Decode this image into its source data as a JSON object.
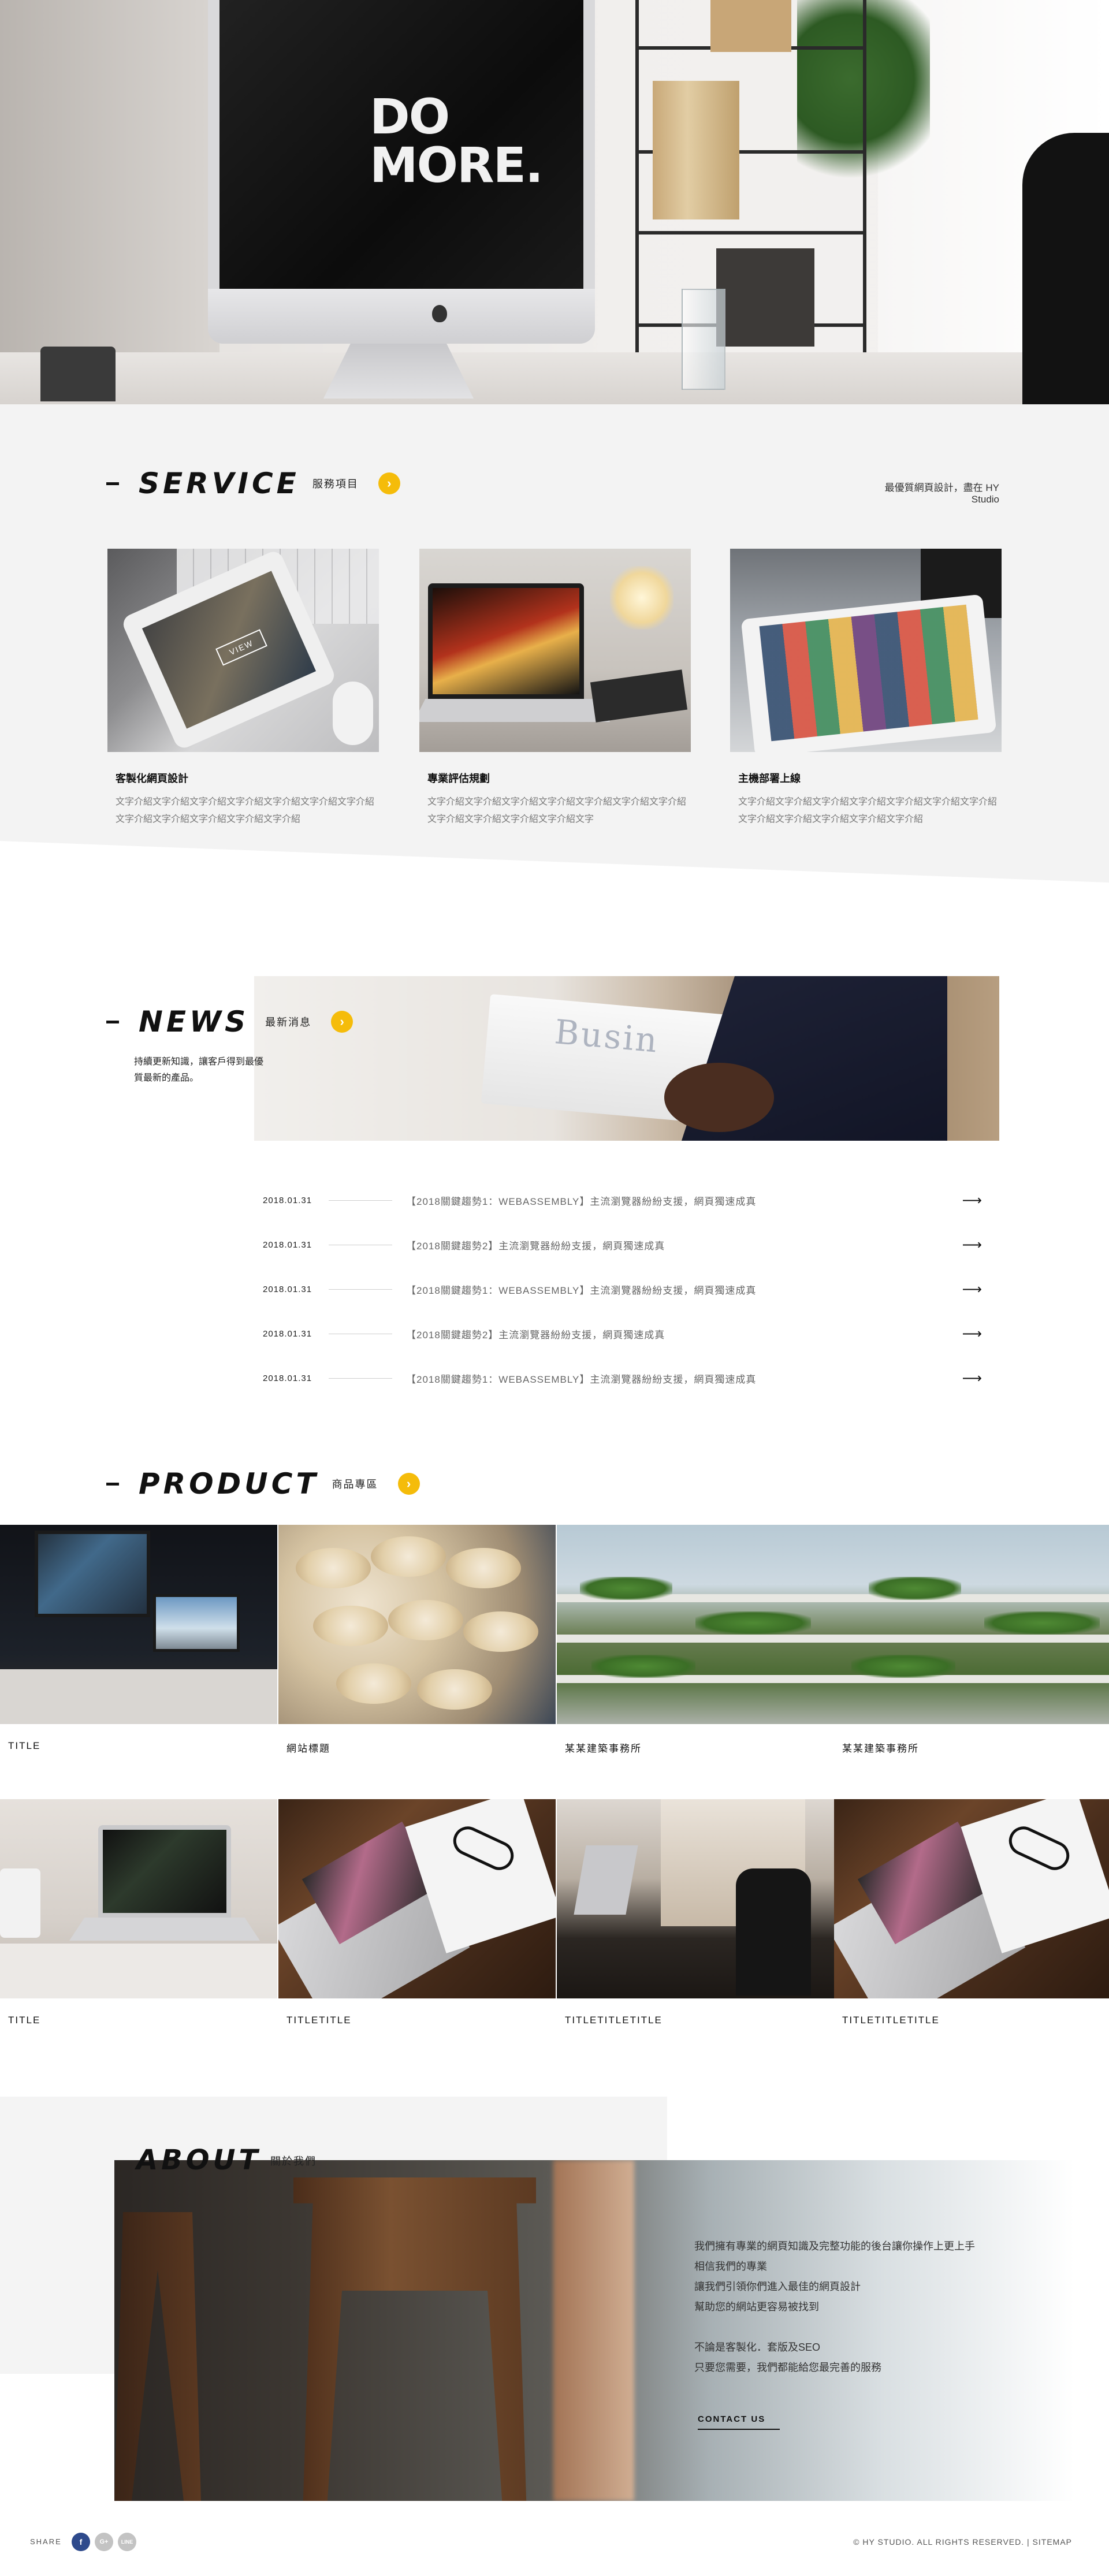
{
  "hero": {
    "headline_line1": "DO",
    "headline_line2": "MORE."
  },
  "service": {
    "title": "SERVICE",
    "subtitle": "服務項目",
    "tagline": "最優質網頁設計，盡在 HY Studio",
    "arrow_icon": "arrow-right-icon",
    "cards": [
      {
        "title": "客製化網頁設計",
        "desc": "文字介紹文字介紹文字介紹文字介紹文字介紹文字介紹文字介紹文字介紹文字介紹文字介紹文字介紹文字介紹",
        "overlay": "VIEW"
      },
      {
        "title": "專業評估規劃",
        "desc": "文字介紹文字介紹文字介紹文字介紹文字介紹文字介紹文字介紹文字介紹文字介紹文字介紹文字介紹文字"
      },
      {
        "title": "主機部署上線",
        "desc": "文字介紹文字介紹文字介紹文字介紹文字介紹文字介紹文字介紹文字介紹文字介紹文字介紹文字介紹文字介紹"
      }
    ]
  },
  "news": {
    "title": "NEWS",
    "subtitle": "最新消息",
    "desc": "持續更新知識，讓客戶得到最優質最新的產品。",
    "image_text": "Busin",
    "items": [
      {
        "date": "2018.01.31",
        "text": "【2018關鍵趨勢1：WEBASSEMBLY】主流瀏覽器紛紛支援，網頁獨速成真"
      },
      {
        "date": "2018.01.31",
        "text": "【2018關鍵趨勢2】主流瀏覽器紛紛支援，網頁獨速成真"
      },
      {
        "date": "2018.01.31",
        "text": "【2018關鍵趨勢1：WEBASSEMBLY】主流瀏覽器紛紛支援，網頁獨速成真"
      },
      {
        "date": "2018.01.31",
        "text": "【2018關鍵趨勢2】主流瀏覽器紛紛支援，網頁獨速成真"
      },
      {
        "date": "2018.01.31",
        "text": "【2018關鍵趨勢1：WEBASSEMBLY】主流瀏覽器紛紛支援，網頁獨速成真"
      }
    ],
    "row_arrow": "⟶"
  },
  "product": {
    "title": "PRODUCT",
    "subtitle": "商品專區",
    "items": [
      {
        "title": "TITLE"
      },
      {
        "title": "網站標題"
      },
      {
        "title": "某某建築事務所"
      },
      {
        "title": "某某建築事務所"
      },
      {
        "title": "TITLE"
      },
      {
        "title": "TITLETITLE"
      },
      {
        "title": "TITLETITLETITLE"
      },
      {
        "title": "TITLETITLETITLE"
      }
    ]
  },
  "about": {
    "title": "ABOUT",
    "subtitle": "關於我們",
    "lines": [
      "我們擁有專業的網頁知識及完整功能的後台讓你操作上更上手",
      "相信我們的專業",
      "讓我們引領你們進入最佳的網頁設計",
      "幫助您的網站更容易被找到",
      "",
      "不論是客製化．套版及SEO",
      "只要您需要，我們都能給您最完善的服務"
    ],
    "button": "CONTACT US"
  },
  "footer": {
    "share_label": "SHARE",
    "social": [
      {
        "icon": "facebook-icon",
        "glyph": "f",
        "color": "#3b5998"
      },
      {
        "icon": "google-plus-icon",
        "glyph": "G+",
        "color": "#c3c3c3"
      },
      {
        "icon": "line-icon",
        "glyph": "LINE",
        "color": "#c3c3c3"
      }
    ],
    "copyright": "© HY STUDIO. ALL RIGHTS RESERVED. | SITEMAP"
  },
  "colors": {
    "accent": "#f5bc0a",
    "section_bg": "#f3f3f3",
    "text_dark": "#111111"
  }
}
